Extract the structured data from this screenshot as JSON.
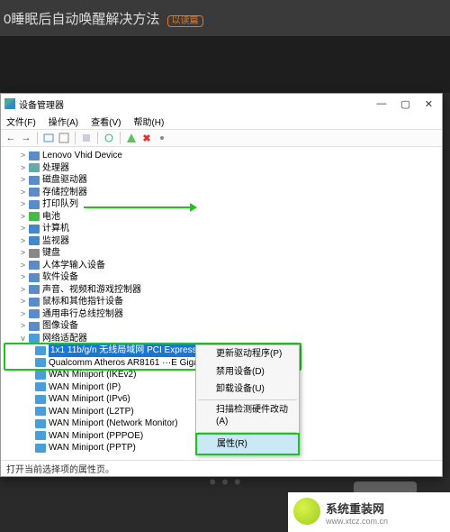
{
  "page": {
    "header_text": "0睡眠后自动唤醒解决方法",
    "header_tag": "以读篇"
  },
  "window": {
    "title": "设备管理器",
    "min": "—",
    "max": "▢",
    "close": "✕"
  },
  "menu": {
    "file": "文件(F)",
    "action": "操作(A)",
    "view": "查看(V)",
    "help": "帮助(H)"
  },
  "toolbar": {
    "back": "←",
    "fwd": "→",
    "refresh": "⟳",
    "stop": "✖"
  },
  "tree": {
    "items": [
      {
        "label": "Lenovo Vhid Device",
        "exp": ">"
      },
      {
        "label": "处理器",
        "exp": ">"
      },
      {
        "label": "磁盘驱动器",
        "exp": ">"
      },
      {
        "label": "存储控制器",
        "exp": ">"
      },
      {
        "label": "打印队列",
        "exp": ">"
      },
      {
        "label": "电池",
        "exp": ">"
      },
      {
        "label": "计算机",
        "exp": ">"
      },
      {
        "label": "监视器",
        "exp": ">"
      },
      {
        "label": "键盘",
        "exp": ">"
      },
      {
        "label": "人体学输入设备",
        "exp": ">"
      },
      {
        "label": "软件设备",
        "exp": ">"
      },
      {
        "label": "声音、视频和游戏控制器",
        "exp": ">"
      },
      {
        "label": "鼠标和其他指针设备",
        "exp": ">"
      },
      {
        "label": "通用串行总线控制器",
        "exp": ">"
      },
      {
        "label": "图像设备",
        "exp": ">"
      },
      {
        "label": "网络适配器",
        "exp": "v"
      }
    ],
    "adapters": [
      {
        "label": "1x1 11b/g/n 无线局域网 PCI Express Half Mini Car",
        "selected": true
      },
      {
        "label": "Qualcomm Atheros AR8161 ···E Gigabit Etherne"
      },
      {
        "label": "WAN Miniport (IKEv2)"
      },
      {
        "label": "WAN Miniport (IP)"
      },
      {
        "label": "WAN Miniport (IPv6)"
      },
      {
        "label": "WAN Miniport (L2TP)"
      },
      {
        "label": "WAN Miniport (Network Monitor)"
      },
      {
        "label": "WAN Miniport (PPPOE)"
      },
      {
        "label": "WAN Miniport (PPTP)"
      }
    ]
  },
  "context_menu": {
    "items": [
      {
        "label": "更新驱动程序(P)"
      },
      {
        "label": "禁用设备(D)"
      },
      {
        "label": "卸载设备(U)"
      },
      {
        "sep": true
      },
      {
        "label": "扫描检测硬件改动(A)"
      },
      {
        "sep": true
      },
      {
        "label": "属性(R)",
        "hl": true
      }
    ]
  },
  "status": "打开当前选择项的属性页。",
  "watermark": {
    "name": "系统重装网",
    "url": "www.xtcz.com.cn"
  }
}
